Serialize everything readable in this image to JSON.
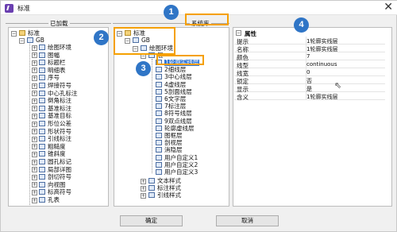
{
  "window": {
    "title": "标准",
    "close_glyph": "✕"
  },
  "left": {
    "group_label": "已加载",
    "root": "标准",
    "gb": "GB",
    "items": [
      "绘图环境",
      "图幅",
      "标题栏",
      "明细表",
      "序号",
      "焊接符号",
      "中心孔标注",
      "倒角标注",
      "基准标注",
      "基准目标",
      "形位公差",
      "形状符号",
      "引线标注",
      "粗糙度",
      "锥斜度",
      "圆孔标记",
      "局部详图",
      "剖切符号",
      "向视图",
      "标高符号",
      "孔表"
    ]
  },
  "middle": {
    "group_label": "系统库",
    "root": "标准",
    "gb": "GB",
    "env": "绘图环境",
    "layer": "层",
    "layers": [
      "1轮廓实线层",
      "2细线层",
      "3中心线层",
      "4虚线层",
      "5剖面线层",
      "6文字层",
      "7标注层",
      "8符号线层",
      "9双点线层",
      "轮廓虚线层",
      "图框层",
      "剖视层",
      "消隐层",
      "用户自定义1",
      "用户自定义2",
      "用户自定义3"
    ],
    "after": [
      "文本样式",
      "标注样式",
      "引线样式"
    ]
  },
  "props": {
    "header": "属性",
    "rows": [
      {
        "k": "提示",
        "v": "1轮廓实线层"
      },
      {
        "k": "名称",
        "v": "1轮廓实线层"
      },
      {
        "k": "颜色",
        "v": "7"
      },
      {
        "k": "线型",
        "v": "continuous"
      },
      {
        "k": "线宽",
        "v": "0"
      },
      {
        "k": "锁定",
        "v": "否"
      },
      {
        "k": "显示",
        "v": "是"
      },
      {
        "k": "含义",
        "v": "1轮廓实线层"
      }
    ]
  },
  "callouts": [
    "1",
    "2",
    "3",
    "4"
  ],
  "buttons": {
    "ok": "确定",
    "cancel": "取消"
  }
}
